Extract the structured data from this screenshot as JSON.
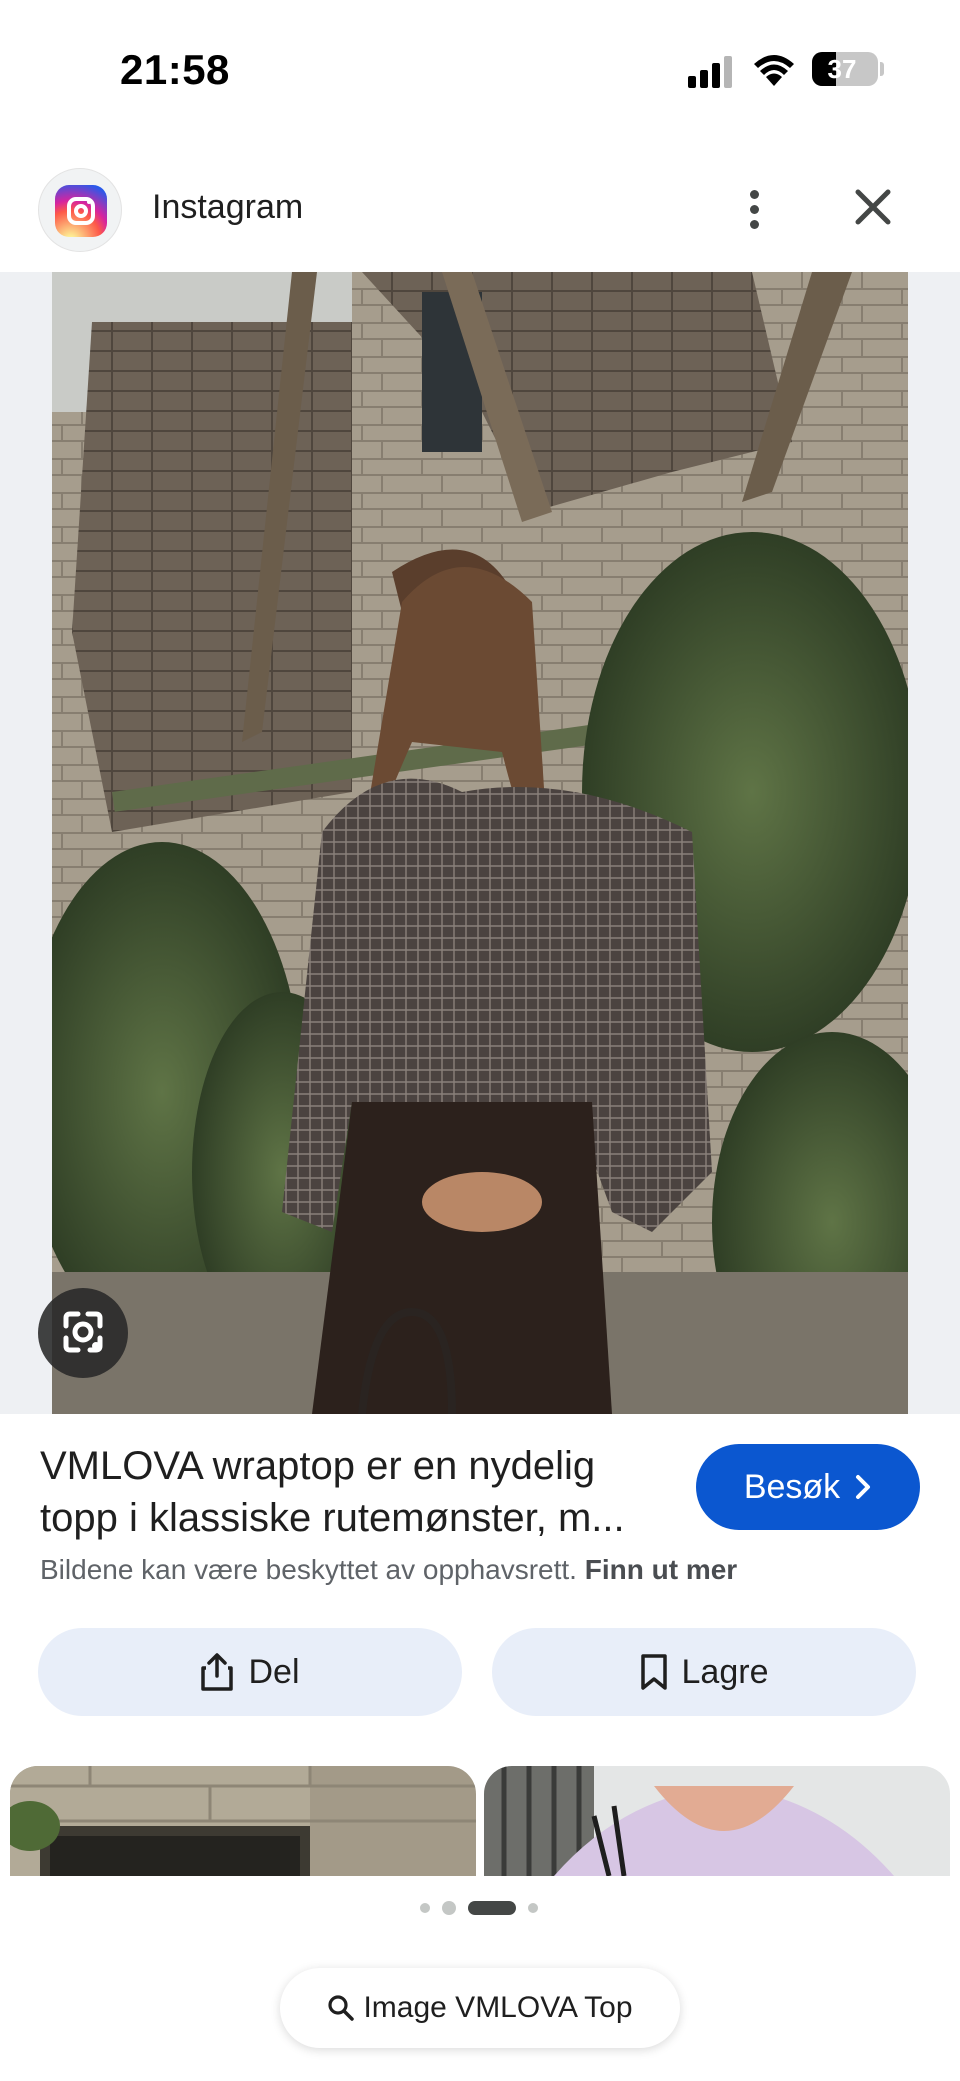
{
  "status_bar": {
    "time": "21:58",
    "battery_level": "37",
    "battery_fraction": 0.37
  },
  "source": {
    "name": "Instagram",
    "icon": "instagram-logo"
  },
  "result": {
    "title": "VMLOVA wraptop er en nydelig topp i klassiske rutemønster, m...",
    "visit_label": "Besøk",
    "copyright_text": "Bildene kan være beskyttet av opphavsrett.",
    "learn_more_label": "Finn ut mer"
  },
  "actions": {
    "share_label": "Del",
    "save_label": "Lagre"
  },
  "pager": {
    "count": 4,
    "active_index": 2
  },
  "search": {
    "label": "Image VMLOVA Top"
  },
  "colors": {
    "accent": "#0b57d0",
    "action_bg": "#e8eef9",
    "muted_text": "#5f6368"
  }
}
